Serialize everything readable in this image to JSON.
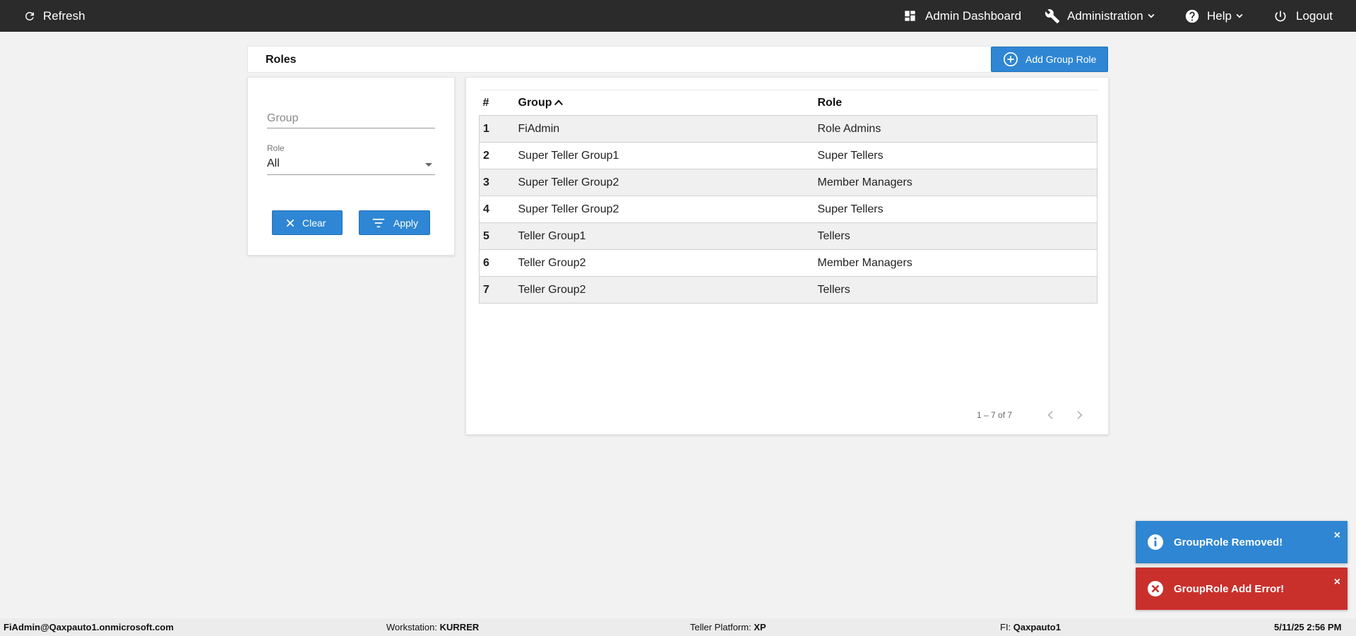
{
  "topbar": {
    "refresh_label": "Refresh",
    "admin_dashboard_label": "Admin Dashboard",
    "administration_label": "Administration",
    "help_label": "Help",
    "logout_label": "Logout"
  },
  "page": {
    "title": "Roles",
    "add_button_label": "Add Group Role"
  },
  "filters": {
    "group_placeholder": "Group",
    "group_value": "",
    "role_label": "Role",
    "role_value": "All",
    "clear_label": "Clear",
    "apply_label": "Apply"
  },
  "table": {
    "headers": {
      "num": "#",
      "group": "Group",
      "role": "Role"
    },
    "sort": {
      "column": "Group",
      "direction": "ascending"
    },
    "rows": [
      {
        "num": "1",
        "group": "FiAdmin",
        "role": "Role Admins"
      },
      {
        "num": "2",
        "group": "Super Teller Group1",
        "role": "Super Tellers"
      },
      {
        "num": "3",
        "group": "Super Teller Group2",
        "role": "Member Managers"
      },
      {
        "num": "4",
        "group": "Super Teller Group2",
        "role": "Super Tellers"
      },
      {
        "num": "5",
        "group": "Teller Group1",
        "role": "Tellers"
      },
      {
        "num": "6",
        "group": "Teller Group2",
        "role": "Member Managers"
      },
      {
        "num": "7",
        "group": "Teller Group2",
        "role": "Tellers"
      }
    ],
    "pagination": "1 – 7 of 7"
  },
  "toasts": [
    {
      "type": "info",
      "message": "GroupRole Removed!",
      "close": "×",
      "color": "#2f86d2"
    },
    {
      "type": "error",
      "message": "GroupRole Add Error!",
      "close": "×",
      "color": "#c9302c"
    }
  ],
  "statusbar": {
    "user": "FiAdmin@Qaxpauto1.onmicrosoft.com",
    "workstation_label": "Workstation:",
    "workstation_value": "KURRER",
    "platform_label": "Teller Platform:",
    "platform_value": "XP",
    "fi_label": "FI:",
    "fi_value": "Qaxpauto1",
    "datetime": "5/11/25 2:56 PM"
  },
  "colors": {
    "topbar_bg": "#2b2b2b",
    "accent_button": "#2e86d4",
    "page_bg": "#f2f2f2"
  },
  "icons": {
    "refresh": "refresh-icon",
    "dashboard": "dashboard-icon",
    "administration": "wrench-icon",
    "help": "help-circle-icon",
    "logout": "power-icon",
    "add": "plus-circle-icon",
    "clear": "close-icon",
    "apply": "filter-icon",
    "info": "info-icon",
    "error": "error-icon"
  }
}
